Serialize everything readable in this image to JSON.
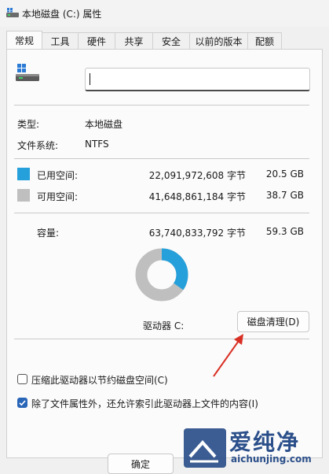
{
  "window": {
    "title": "本地磁盘 (C:) 属性",
    "icon": "drive-icon"
  },
  "tabs": [
    "常规",
    "工具",
    "硬件",
    "共享",
    "安全",
    "以前的版本",
    "配额"
  ],
  "active_tab": "常规",
  "general": {
    "name_value": "",
    "type_label": "类型:",
    "type_value": "本地磁盘",
    "fs_label": "文件系统:",
    "fs_value": "NTFS",
    "used_label": "已用空间:",
    "used_bytes": "22,091,972,608 字节",
    "used_size": "20.5 GB",
    "free_label": "可用空间:",
    "free_bytes": "41,648,861,184 字节",
    "free_size": "38.7 GB",
    "capacity_label": "容量:",
    "capacity_bytes": "63,740,833,792 字节",
    "capacity_size": "59.3 GB",
    "drive_label": "驱动器 C:",
    "cleanup_button": "磁盘清理(D)",
    "compress_label": "压缩此驱动器以节约磁盘空间(C)",
    "compress_checked": false,
    "index_label": "除了文件属性外，还允许索引此驱动器上文件的内容(I)",
    "index_checked": true
  },
  "usage": {
    "used_fraction": 0.347,
    "used_color": "#26a0da",
    "free_color": "#bfbfbf"
  },
  "footer": {
    "ok_button": "确定"
  },
  "watermark": {
    "text": "爱纯净",
    "url": "aichunjing.com"
  }
}
